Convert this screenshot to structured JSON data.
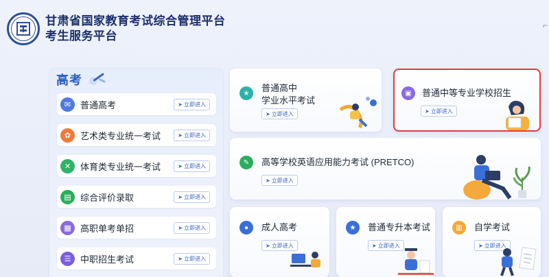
{
  "header": {
    "title_line1": "甘肃省国家教育考试综合管理平台",
    "title_line2": "考生服务平台"
  },
  "gaokao": {
    "title": "高考",
    "enter_label": "立即进入",
    "items": [
      {
        "label": "普通高考",
        "color": "#4f7be0"
      },
      {
        "label": "艺术类专业统一考试",
        "color": "#f07a3a"
      },
      {
        "label": "体育类专业统一考试",
        "color": "#2fb36a"
      },
      {
        "label": "综合评价录取",
        "color": "#2aae5b"
      },
      {
        "label": "高职单考单招",
        "color": "#8a6ae0"
      },
      {
        "label": "中职招生考试",
        "color": "#7a5ee0"
      }
    ]
  },
  "cards": {
    "enter_label": "立即进入",
    "xueye_line1": "普通高中",
    "xueye_line2": "学业水平考试",
    "zhongzhuan": "普通中等专业学校招生",
    "pretco": "高等学校英语应用能力考试 (PRETCO)",
    "chengren": "成人高考",
    "zhuanshengben": "普通专升本考试",
    "zixue": "自学考试"
  },
  "colors": {
    "accent": "#2a5cc9",
    "selected_border": "#e23b3b"
  }
}
